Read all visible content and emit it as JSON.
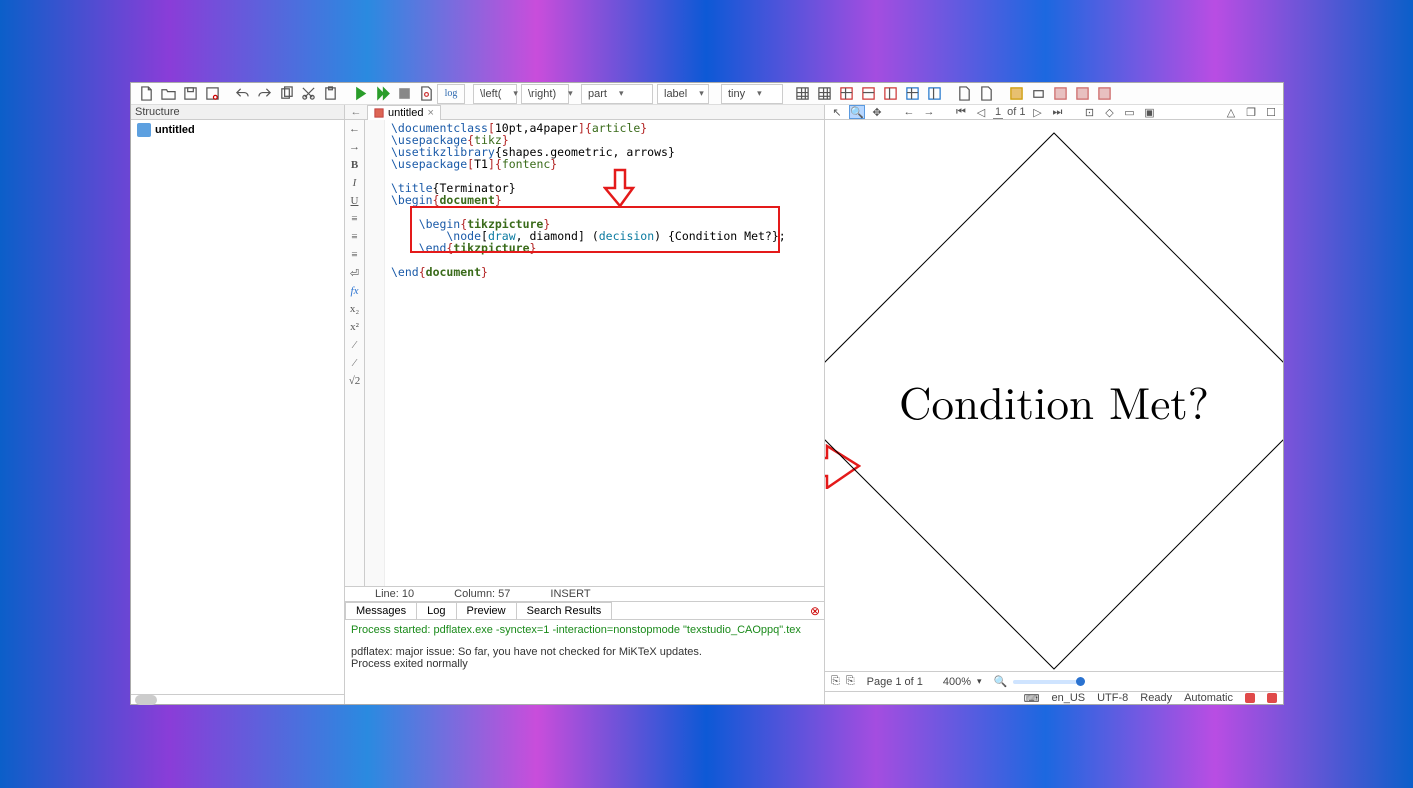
{
  "structure": {
    "title": "Structure",
    "root": "untitled"
  },
  "tab": {
    "name": "untitled"
  },
  "code": {
    "l1a": "\\documentclass",
    "l1b": "[",
    "l1c": "10pt,a4paper",
    "l1d": "]{",
    "l1e": "article",
    "l1f": "}",
    "l2a": "\\usepackage",
    "l2b": "{",
    "l2c": "tikz",
    "l2d": "}",
    "l3a": "\\usetikzlibrary",
    "l3b": "{shapes.geometric, arrows}",
    "l4a": "\\usepackage",
    "l4b": "[",
    "l4c": "T1",
    "l4d": "]{",
    "l4e": "fontenc",
    "l4f": "}",
    "l6a": "\\title",
    "l6b": "{Terminator}",
    "l7a": "\\begin",
    "l7b": "{",
    "l7c": "document",
    "l7d": "}",
    "l9a": "    \\begin",
    "l9b": "{",
    "l9c": "tikzpicture",
    "l9d": "}",
    "l10a": "        \\node",
    "l10b": "[",
    "l10c": "draw",
    "l10d": ", diamond] (",
    "l10e": "decision",
    "l10f": ") {Condition Met?};",
    "l11a": "    \\end",
    "l11b": "{",
    "l11c": "tikzpicture",
    "l11d": "}",
    "l13a": "\\end",
    "l13b": "{",
    "l13c": "document",
    "l13d": "}"
  },
  "status": {
    "line": "Line: 10",
    "col": "Column: 57",
    "mode": "INSERT"
  },
  "msgtabs": {
    "a": "Messages",
    "b": "Log",
    "c": "Preview",
    "d": "Search Results"
  },
  "msgs": {
    "cmd": "Process started: pdflatex.exe -synctex=1 -interaction=nonstopmode \"texstudio_CAOppq\".tex",
    "warn": "pdflatex: major issue: So far, you have not checked for MiKTeX updates.",
    "done": "Process exited normally"
  },
  "toolbar": {
    "left": "\\left(",
    "right": "\\right)",
    "part": "part",
    "label": "label",
    "tiny": "tiny",
    "log": "log"
  },
  "pv": {
    "page_cur": "1",
    "page_of": "of 1",
    "pginfo": "Page 1 of 1",
    "zoom": "400%",
    "diamond": "Condition Met?",
    "lang": "en_US",
    "enc": "UTF-8",
    "state": "Ready",
    "auto": "Automatic"
  },
  "side": {
    "b": "B",
    "i": "I",
    "u": "U",
    "fx": "fx",
    "x2": "x₂",
    "xp": "x²",
    "sq": "√2"
  }
}
